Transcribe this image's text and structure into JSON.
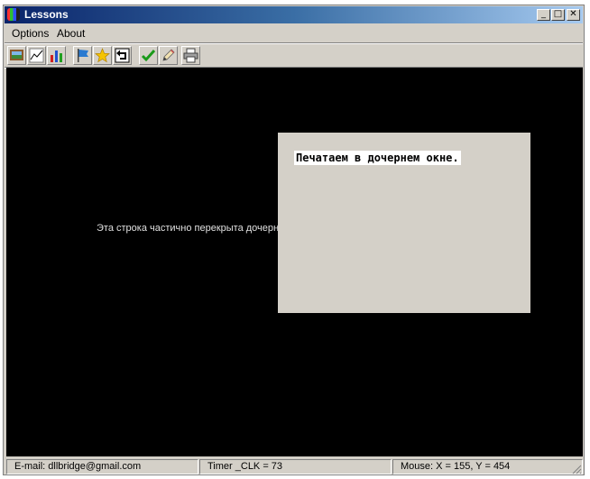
{
  "window": {
    "title": "Lessons",
    "controls": {
      "minimize": "_",
      "maximize": "□",
      "close": "✕"
    }
  },
  "menu": {
    "items": [
      "Options",
      "About"
    ]
  },
  "toolbar": {
    "buttons": [
      {
        "icon": "picture-icon"
      },
      {
        "icon": "line-chart-icon"
      },
      {
        "icon": "bar-chart-icon"
      },
      {
        "icon": "flag-icon"
      },
      {
        "icon": "star-icon"
      },
      {
        "icon": "undo-arrow-icon"
      },
      {
        "icon": "checkmark-icon"
      },
      {
        "icon": "pencil-icon"
      },
      {
        "icon": "printer-icon"
      }
    ]
  },
  "canvas": {
    "background": "#000000",
    "partial_text": "Эта строка частично перекрыта дочерн",
    "child_window": {
      "text": "Печатаем в дочернем окне."
    }
  },
  "status": {
    "email": "E-mail: dllbridge@gmail.com",
    "timer": "Timer _CLK = 73",
    "mouse": "Mouse: X = 155, Y = 454"
  }
}
